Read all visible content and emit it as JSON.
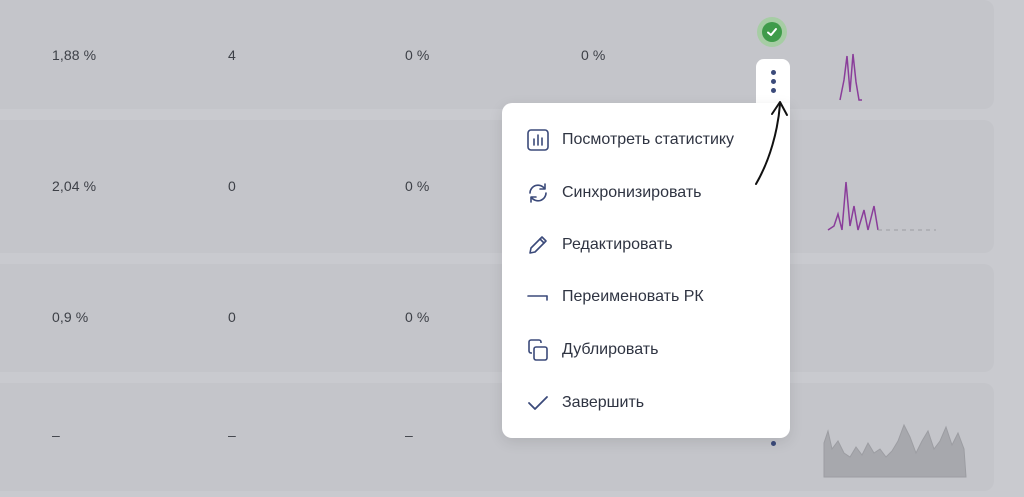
{
  "rows": [
    {
      "col1": "1,88 %",
      "col2": "4",
      "col3": "0 %",
      "col4": "0 %"
    },
    {
      "col1": "2,04 %",
      "col2": "0",
      "col3": "0 %",
      "col4": ""
    },
    {
      "col1": "0,9 %",
      "col2": "0",
      "col3": "0 %",
      "col4": ""
    },
    {
      "col1": "–",
      "col2": "–",
      "col3": "–",
      "col4": ""
    }
  ],
  "status": {
    "icon": "check-circle-icon",
    "color": "#3f9b4a"
  },
  "menu": {
    "items": [
      {
        "label": "Посмотреть статистику",
        "icon": "chart-icon"
      },
      {
        "label": "Синхронизировать",
        "icon": "sync-icon"
      },
      {
        "label": "Редактировать",
        "icon": "pencil-icon"
      },
      {
        "label": "Переименовать РК",
        "icon": "rename-icon"
      },
      {
        "label": "Дублировать",
        "icon": "duplicate-icon"
      },
      {
        "label": "Завершить",
        "icon": "check-icon"
      }
    ]
  },
  "colors": {
    "sparkline_purple": "#8a3d9a",
    "sparkline_gray": "#9c9da2",
    "overlay_bg": "#c9cacf",
    "menu_bg": "#ffffff"
  }
}
